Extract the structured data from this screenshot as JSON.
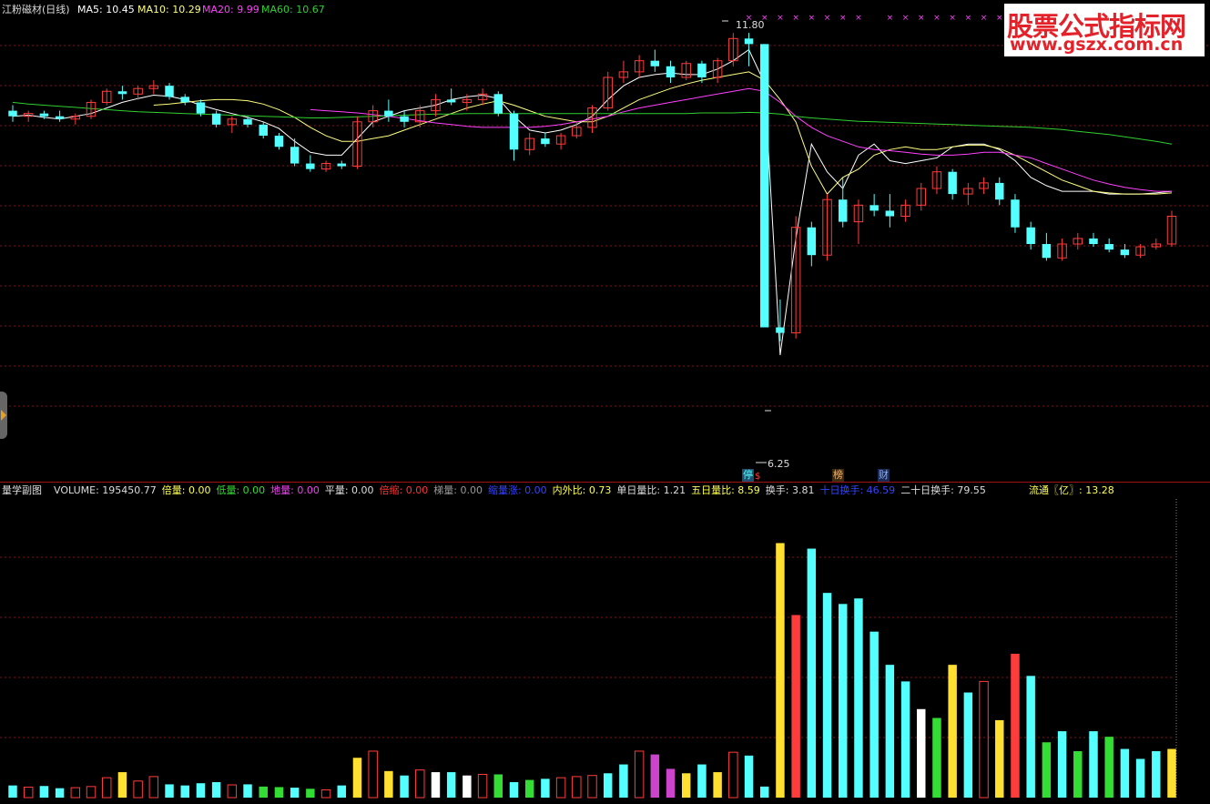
{
  "main_header": {
    "title": "江粉磁材(日线)",
    "ma5": "MA5: 10.45",
    "ma10": "MA10: 10.29",
    "ma20": "MA20: 9.99",
    "ma60": "MA60: 10.67"
  },
  "annotations": {
    "high": "11.80",
    "low": "6.25",
    "marks": [
      "停",
      "$",
      "榜",
      "财"
    ]
  },
  "watermark": {
    "line1": "股票公式指标网",
    "line2": "www.gszx.com.cn"
  },
  "sub_header": {
    "name": "量学副图",
    "items": [
      {
        "text": "VOLUME: 195450.77",
        "color": "#dddddd"
      },
      {
        "text": "倍量: 0.00",
        "color": "#ffff55"
      },
      {
        "text": "低量: 0.00",
        "color": "#33dd33"
      },
      {
        "text": "地量: 0.00",
        "color": "#ee44ee"
      },
      {
        "text": "平量: 0.00",
        "color": "#dddddd"
      },
      {
        "text": "倍缩: 0.00",
        "color": "#ff3333"
      },
      {
        "text": "梯量: 0.00",
        "color": "#999999"
      },
      {
        "text": "缩量涨: 0.00",
        "color": "#3344ff"
      },
      {
        "text": "内外比: 0.73",
        "color": "#ffff55"
      },
      {
        "text": "单日量比: 1.21",
        "color": "#dddddd"
      },
      {
        "text": "五日量比: 8.59",
        "color": "#ffff55"
      },
      {
        "text": "换手: 3.81",
        "color": "#dddddd"
      },
      {
        "text": "十日换手: 46.59",
        "color": "#3344ff"
      },
      {
        "text": "二十日换手: 79.55",
        "color": "#dddddd"
      },
      {
        "text": "流通〖亿〗: 13.28",
        "color": "#ffff55"
      }
    ]
  },
  "colors": {
    "up": "#ff3c3c",
    "down": "#54ffff",
    "ma5": "#ffffff",
    "ma10": "#ffff80",
    "ma20": "#ff40ff",
    "ma60": "#30d030",
    "grid": "#8a1010",
    "separator": "#a01010"
  },
  "chart_data": [
    {
      "type": "candlestick",
      "title": "江粉磁材(日线)",
      "ylim": [
        6.0,
        12.0
      ],
      "series": [
        {
          "name": "MA5",
          "values": [
            10.3,
            10.32,
            10.28,
            10.25,
            10.3,
            10.35,
            10.45,
            10.55,
            10.62,
            10.68,
            10.66,
            10.6,
            10.5,
            10.42,
            10.35,
            10.28,
            10.2,
            10.08,
            9.85,
            9.65,
            9.6,
            9.6,
            9.9,
            10.2,
            10.3,
            10.4,
            10.45,
            10.5,
            10.6,
            10.65,
            10.68,
            10.62,
            10.3,
            10.05,
            10.0,
            10.05,
            10.15,
            10.3,
            10.6,
            10.85,
            11.0,
            11.05,
            11.08,
            11.05,
            11.05,
            11.15,
            11.3,
            11.5,
            10.9,
            6.0,
            8.1,
            9.8,
            9.3,
            9.0,
            9.6,
            9.8,
            9.5,
            9.45,
            9.5,
            9.55,
            9.75,
            9.8,
            9.8,
            9.7,
            9.5,
            9.2,
            9.05,
            8.95,
            8.95,
            8.95,
            8.9,
            8.9,
            8.9,
            8.92,
            8.95
          ]
        },
        {
          "name": "MA10",
          "values": [
            null,
            null,
            null,
            null,
            null,
            null,
            null,
            null,
            null,
            10.5,
            10.52,
            10.55,
            10.58,
            10.6,
            10.6,
            10.58,
            10.52,
            10.42,
            10.28,
            10.1,
            9.95,
            9.85,
            9.85,
            9.9,
            9.95,
            10.05,
            10.15,
            10.25,
            10.35,
            10.45,
            10.52,
            10.58,
            10.5,
            10.4,
            10.3,
            10.25,
            10.2,
            10.2,
            10.3,
            10.45,
            10.6,
            10.7,
            10.8,
            10.88,
            10.95,
            11.0,
            11.05,
            11.1,
            10.95,
            10.6,
            10.2,
            9.4,
            8.9,
            9.2,
            9.35,
            9.6,
            9.7,
            9.75,
            9.7,
            9.7,
            9.75,
            9.78,
            9.78,
            9.72,
            9.6,
            9.45,
            9.3,
            9.15,
            9.05,
            8.95,
            8.92,
            8.9,
            8.9,
            8.9,
            8.92
          ]
        },
        {
          "name": "MA20",
          "values": [
            null,
            null,
            null,
            null,
            null,
            null,
            null,
            null,
            null,
            null,
            null,
            null,
            null,
            null,
            null,
            null,
            null,
            null,
            null,
            10.42,
            10.4,
            10.38,
            10.36,
            10.33,
            10.3,
            10.26,
            10.22,
            10.18,
            10.15,
            10.12,
            10.1,
            10.1,
            10.1,
            10.1,
            10.12,
            10.15,
            10.2,
            10.25,
            10.3,
            10.38,
            10.45,
            10.5,
            10.55,
            10.6,
            10.65,
            10.7,
            10.75,
            10.8,
            10.75,
            10.55,
            10.3,
            10.1,
            9.95,
            9.85,
            9.75,
            9.7,
            9.68,
            9.65,
            9.62,
            9.6,
            9.6,
            9.62,
            9.65,
            9.65,
            9.6,
            9.55,
            9.45,
            9.35,
            9.25,
            9.15,
            9.08,
            9.02,
            8.98,
            8.95,
            8.95
          ]
        },
        {
          "name": "MA60",
          "values": [
            10.55,
            10.52,
            10.5,
            10.48,
            10.46,
            10.44,
            10.42,
            10.4,
            10.38,
            10.37,
            10.36,
            10.35,
            10.34,
            10.33,
            10.32,
            10.31,
            10.3,
            10.29,
            10.28,
            10.27,
            10.27,
            10.28,
            10.29,
            10.3,
            10.31,
            10.32,
            10.33,
            10.34,
            10.34,
            10.35,
            10.35,
            10.35,
            10.35,
            10.35,
            10.35,
            10.35,
            10.35,
            10.35,
            10.35,
            10.35,
            10.35,
            10.35,
            10.35,
            10.35,
            10.36,
            10.36,
            10.36,
            10.37,
            10.36,
            10.34,
            10.3,
            10.27,
            10.25,
            10.23,
            10.21,
            10.2,
            10.19,
            10.18,
            10.17,
            10.16,
            10.15,
            10.14,
            10.13,
            10.12,
            10.11,
            10.1,
            10.08,
            10.06,
            10.03,
            10.0,
            9.97,
            9.93,
            9.89,
            9.85,
            9.8
          ]
        }
      ],
      "ohlc": [
        [
          10.4,
          10.5,
          10.2,
          10.3
        ],
        [
          10.3,
          10.4,
          10.2,
          10.35
        ],
        [
          10.35,
          10.4,
          10.25,
          10.3
        ],
        [
          10.3,
          10.4,
          10.2,
          10.25
        ],
        [
          10.25,
          10.35,
          10.15,
          10.3
        ],
        [
          10.3,
          10.6,
          10.25,
          10.55
        ],
        [
          10.55,
          10.8,
          10.5,
          10.75
        ],
        [
          10.75,
          10.85,
          10.6,
          10.7
        ],
        [
          10.7,
          10.85,
          10.6,
          10.8
        ],
        [
          10.8,
          10.95,
          10.7,
          10.85
        ],
        [
          10.85,
          10.9,
          10.6,
          10.65
        ],
        [
          10.65,
          10.7,
          10.5,
          10.55
        ],
        [
          10.55,
          10.6,
          10.3,
          10.35
        ],
        [
          10.35,
          10.4,
          10.1,
          10.15
        ],
        [
          10.15,
          10.3,
          10.0,
          10.25
        ],
        [
          10.25,
          10.3,
          10.1,
          10.15
        ],
        [
          10.15,
          10.2,
          9.9,
          9.95
        ],
        [
          9.95,
          10.0,
          9.7,
          9.75
        ],
        [
          9.75,
          9.9,
          9.4,
          9.45
        ],
        [
          9.45,
          9.6,
          9.3,
          9.35
        ],
        [
          9.35,
          9.5,
          9.3,
          9.45
        ],
        [
          9.45,
          9.5,
          9.35,
          9.4
        ],
        [
          9.4,
          10.3,
          9.35,
          10.2
        ],
        [
          10.2,
          10.5,
          10.1,
          10.4
        ],
        [
          10.4,
          10.6,
          10.2,
          10.3
        ],
        [
          10.3,
          10.4,
          10.1,
          10.2
        ],
        [
          10.2,
          10.5,
          10.1,
          10.4
        ],
        [
          10.4,
          10.7,
          10.3,
          10.6
        ],
        [
          10.6,
          10.8,
          10.5,
          10.55
        ],
        [
          10.55,
          10.7,
          10.4,
          10.6
        ],
        [
          10.6,
          10.8,
          10.5,
          10.7
        ],
        [
          10.7,
          10.75,
          10.3,
          10.35
        ],
        [
          10.35,
          10.4,
          9.5,
          9.7
        ],
        [
          9.7,
          10.0,
          9.6,
          9.9
        ],
        [
          9.9,
          10.0,
          9.75,
          9.8
        ],
        [
          9.8,
          10.0,
          9.7,
          9.95
        ],
        [
          9.95,
          10.2,
          9.9,
          10.1
        ],
        [
          10.1,
          10.5,
          10.0,
          10.45
        ],
        [
          10.45,
          11.1,
          10.4,
          11.0
        ],
        [
          11.0,
          11.3,
          10.9,
          11.1
        ],
        [
          11.1,
          11.4,
          11.0,
          11.3
        ],
        [
          11.3,
          11.5,
          11.1,
          11.2
        ],
        [
          11.2,
          11.3,
          10.9,
          11.0
        ],
        [
          11.0,
          11.3,
          10.95,
          11.25
        ],
        [
          11.25,
          11.3,
          10.9,
          11.0
        ],
        [
          11.0,
          11.35,
          10.9,
          11.3
        ],
        [
          11.3,
          11.8,
          11.2,
          11.7
        ],
        [
          11.7,
          11.8,
          11.2,
          11.6
        ],
        [
          11.6,
          11.6,
          6.5,
          6.5
        ],
        [
          6.5,
          7.0,
          6.25,
          6.4
        ],
        [
          6.4,
          8.5,
          6.3,
          8.3
        ],
        [
          8.3,
          8.4,
          7.6,
          7.8
        ],
        [
          7.8,
          8.9,
          7.7,
          8.8
        ],
        [
          8.8,
          9.2,
          8.3,
          8.4
        ],
        [
          8.4,
          8.8,
          8.0,
          8.7
        ],
        [
          8.7,
          8.9,
          8.5,
          8.6
        ],
        [
          8.6,
          8.9,
          8.3,
          8.5
        ],
        [
          8.5,
          8.8,
          8.4,
          8.7
        ],
        [
          8.7,
          9.1,
          8.6,
          9.0
        ],
        [
          9.0,
          9.4,
          8.9,
          9.3
        ],
        [
          9.3,
          9.35,
          8.8,
          8.9
        ],
        [
          8.9,
          9.1,
          8.7,
          9.0
        ],
        [
          9.0,
          9.2,
          8.9,
          9.1
        ],
        [
          9.1,
          9.2,
          8.7,
          8.8
        ],
        [
          8.8,
          8.9,
          8.2,
          8.3
        ],
        [
          8.3,
          8.4,
          7.9,
          8.0
        ],
        [
          8.0,
          8.2,
          7.7,
          7.75
        ],
        [
          7.75,
          8.1,
          7.7,
          8.0
        ],
        [
          8.0,
          8.2,
          7.9,
          8.1
        ],
        [
          8.1,
          8.2,
          7.95,
          8.0
        ],
        [
          8.0,
          8.1,
          7.85,
          7.9
        ],
        [
          7.9,
          8.0,
          7.75,
          7.8
        ],
        [
          7.8,
          8.0,
          7.75,
          7.95
        ],
        [
          7.95,
          8.1,
          7.9,
          8.0
        ],
        [
          8.0,
          8.6,
          7.95,
          8.5
        ]
      ]
    },
    {
      "type": "bar",
      "title": "量学副图",
      "ylim": [
        0,
        2600000
      ],
      "values": [
        110000,
        95000,
        105000,
        85000,
        90000,
        100000,
        180000,
        230000,
        150000,
        190000,
        120000,
        110000,
        130000,
        140000,
        115000,
        120000,
        100000,
        95000,
        90000,
        80000,
        70000,
        110000,
        360000,
        420000,
        240000,
        200000,
        250000,
        230000,
        230000,
        200000,
        210000,
        210000,
        140000,
        160000,
        170000,
        180000,
        190000,
        200000,
        220000,
        300000,
        420000,
        390000,
        260000,
        220000,
        300000,
        230000,
        410000,
        380000,
        100000,
        2300000,
        1650000,
        2250000,
        1850000,
        1750000,
        1800000,
        1500000,
        1200000,
        1050000,
        800000,
        720000,
        1200000,
        950000,
        1050000,
        700000,
        1300000,
        1100000,
        500000,
        600000,
        420000,
        600000,
        550000,
        440000,
        350000,
        420000,
        440000
      ]
    }
  ]
}
